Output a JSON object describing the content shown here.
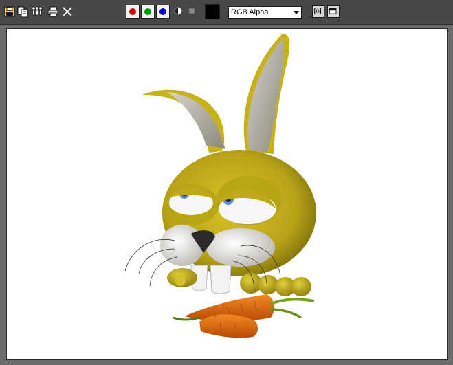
{
  "toolbar": {
    "icons": [
      {
        "name": "save-icon"
      },
      {
        "name": "copy-icon"
      },
      {
        "name": "clone-frame-icon"
      },
      {
        "name": "print-icon"
      },
      {
        "name": "clear-icon"
      }
    ],
    "channels": [
      {
        "name": "red-channel-button",
        "color": "#d90000",
        "enabled": true
      },
      {
        "name": "green-channel-button",
        "color": "#009000",
        "enabled": true
      },
      {
        "name": "blue-channel-button",
        "color": "#0000c8",
        "enabled": true
      }
    ],
    "monochrome_icon": "monochrome-icon",
    "clear_channel_icon": "clear-channel-icon",
    "swatch_color": "#000000",
    "display_channel": {
      "selected": "RGB Alpha"
    },
    "view_buttons": [
      {
        "name": "split-view-icon"
      },
      {
        "name": "display-window-icon"
      }
    ]
  },
  "render": {
    "background": "#ffffff",
    "subject": "bunny-with-carrots",
    "colors": {
      "fur": "#c9b420",
      "fur_dark": "#8a7a10",
      "ear_inner": "#b8b3a8",
      "teeth": "#efefef",
      "carrot": "#e06a10",
      "carrot_leaf": "#78a020"
    }
  }
}
